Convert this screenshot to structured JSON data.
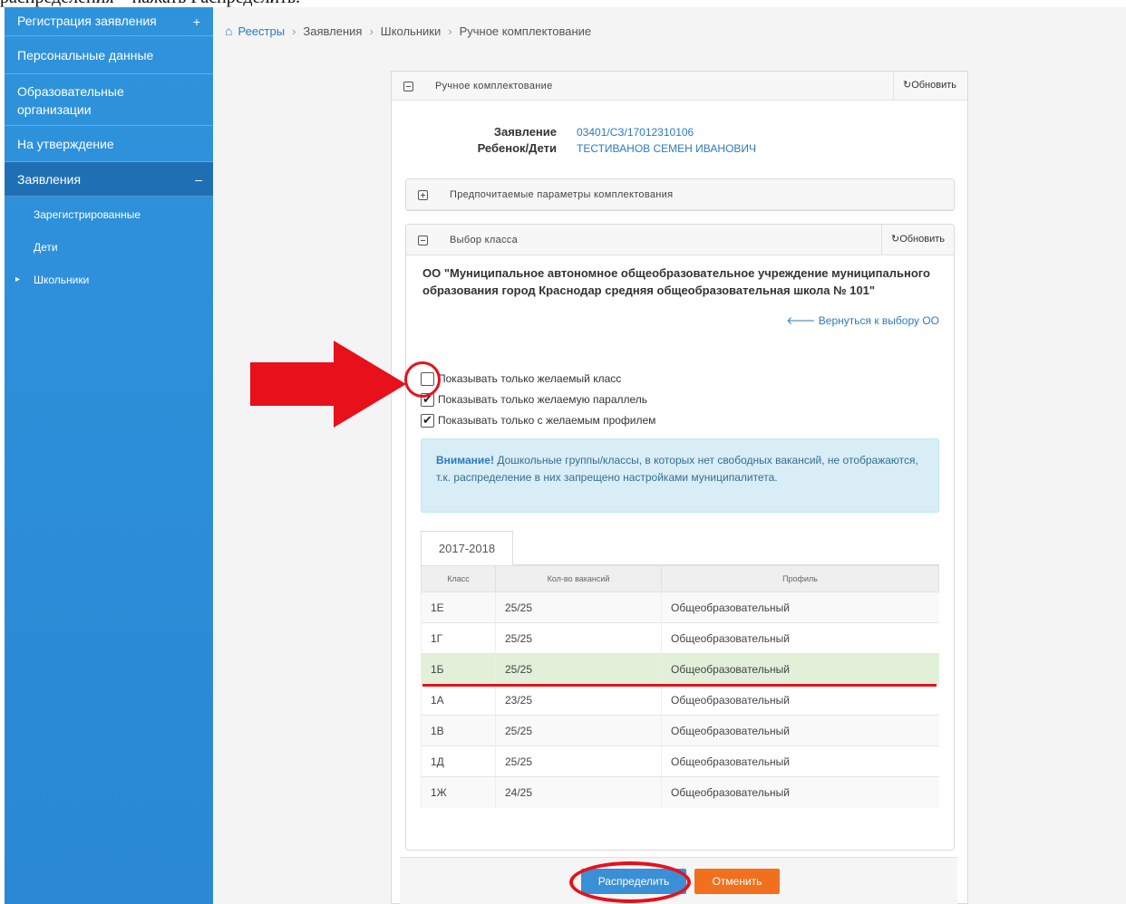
{
  "caption": "распределения – нажать Распределить.",
  "sidebar": {
    "register": "Регистрация заявления",
    "register_icon": "+",
    "personal": "Персональные данные",
    "orgs": "Образовательные организации",
    "approval": "На утверждение",
    "applications": "Заявления",
    "applications_icon": "–",
    "registered": "Зарегистрированные",
    "children": "Дети",
    "pupils": "Школьники"
  },
  "breadcrumb": {
    "items": [
      "Реестры",
      "Заявления",
      "Школьники",
      "Ручное комплектование"
    ]
  },
  "panel": {
    "title": "Ручное комплектование",
    "refresh": "Обновить"
  },
  "info": {
    "application_label": "Заявление",
    "application_value": "03401/СЗ/17012310106",
    "child_label": "Ребенок/Дети",
    "child_value": "ТЕСТИВАНОВ СЕМЕН ИВАНОВИЧ"
  },
  "prefs_panel": {
    "title": "Предпочитаемые параметры комплектования"
  },
  "class_panel": {
    "title": "Выбор класса",
    "refresh": "Обновить",
    "org_name": "ОО \"Муниципальное автономное общеобразовательное учреждение муниципального образования город Краснодар средняя общеобразовательная школа № 101\"",
    "back": "Вернуться к выбору ОО",
    "checkboxes": [
      {
        "label": "Показывать только желаемый класс",
        "checked": false
      },
      {
        "label": "Показывать только желаемую параллель",
        "checked": true
      },
      {
        "label": "Показывать только с желаемым профилем",
        "checked": true
      }
    ],
    "alert_strong": "Внимание!",
    "alert_text": " Дошкольные группы/классы, в которых нет свободных вакансий, не отображаются, т.к. распределение в них запрещено настройками муниципалитета.",
    "year_tab": "2017-2018",
    "table": {
      "headers": [
        "Класс",
        "Кол-во вакансий",
        "Профиль"
      ],
      "rows": [
        {
          "cls": "1Е",
          "vac": "25/25",
          "profile": "Общеобразовательный"
        },
        {
          "cls": "1Г",
          "vac": "25/25",
          "profile": "Общеобразовательный"
        },
        {
          "cls": "1Б",
          "vac": "25/25",
          "profile": "Общеобразовательный"
        },
        {
          "cls": "1А",
          "vac": "23/25",
          "profile": "Общеобразовательный"
        },
        {
          "cls": "1В",
          "vac": "25/25",
          "profile": "Общеобразовательный"
        },
        {
          "cls": "1Д",
          "vac": "25/25",
          "profile": "Общеобразовательный"
        },
        {
          "cls": "1Ж",
          "vac": "24/25",
          "profile": "Общеобразовательный"
        }
      ],
      "selected_index": 2
    }
  },
  "buttons": {
    "distribute": "Распределить",
    "cancel": "Отменить"
  },
  "colors": {
    "sidebar": "#2f93dc",
    "accent": "#2a7bc1",
    "annotation": "#e8101a",
    "selected_row": "#e2efd9",
    "cancel": "#f0701e"
  }
}
